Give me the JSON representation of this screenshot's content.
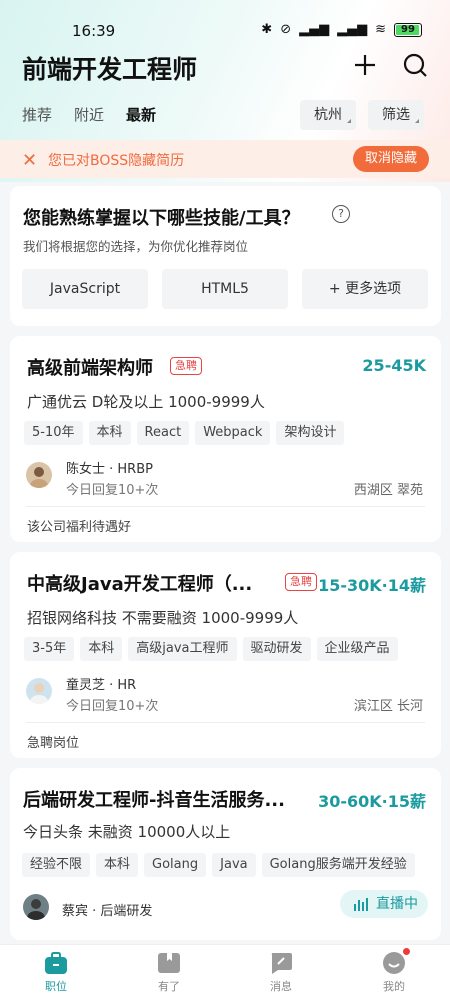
{
  "status": {
    "time": "16:39",
    "battery": "99"
  },
  "header": {
    "title": "前端开发工程师"
  },
  "tabs": [
    {
      "label": "推荐"
    },
    {
      "label": "附近"
    },
    {
      "label": "最新"
    }
  ],
  "filters": {
    "city": "杭州",
    "filter": "筛选"
  },
  "banner": {
    "text": "您已对BOSS隐藏简历",
    "action": "取消隐藏"
  },
  "skills": {
    "title": "您能熟练掌握以下哪些技能/工具？",
    "subtitle": "我们将根据您的选择，为你优化推荐岗位",
    "options": [
      "JavaScript",
      "HTML5",
      "+ 更多选项"
    ]
  },
  "jobs": [
    {
      "title": "高级前端架构师",
      "urgent": "急聘",
      "salary": "25-45K",
      "company": "广通优云  D轮及以上  1000-9999人",
      "tags": [
        "5-10年",
        "本科",
        "React",
        "Webpack",
        "架构设计"
      ],
      "recruiter": "陈女士 · HRBP",
      "reply": "今日回复10+次",
      "location": "西湖区  翠苑",
      "note": "该公司福利待遇好"
    },
    {
      "title": "中高级Java开发工程师（...",
      "urgent": "急聘",
      "salary": "15-30K·14薪",
      "company": "招银网络科技  不需要融资  1000-9999人",
      "tags": [
        "3-5年",
        "本科",
        "高级java工程师",
        "驱动研发",
        "企业级产品"
      ],
      "recruiter": "童灵芝 · HR",
      "reply": "今日回复10+次",
      "location": "滨江区  长河",
      "note": "急聘岗位"
    },
    {
      "title": "后端研发工程师-抖音生活服务...",
      "salary": "30-60K·15薪",
      "company": "今日头条  未融资  10000人以上",
      "tags": [
        "经验不限",
        "本科",
        "Golang",
        "Java",
        "Golang服务端开发经验"
      ],
      "recruiter": "蔡宾 · 后端研发",
      "live": "直播中"
    }
  ],
  "nav": [
    {
      "label": "职位"
    },
    {
      "label": "有了"
    },
    {
      "label": "消息"
    },
    {
      "label": "我的"
    }
  ],
  "colors": {
    "accent": "#1b9aa0",
    "urgent": "#e64545",
    "banner": "#f26b3a"
  }
}
